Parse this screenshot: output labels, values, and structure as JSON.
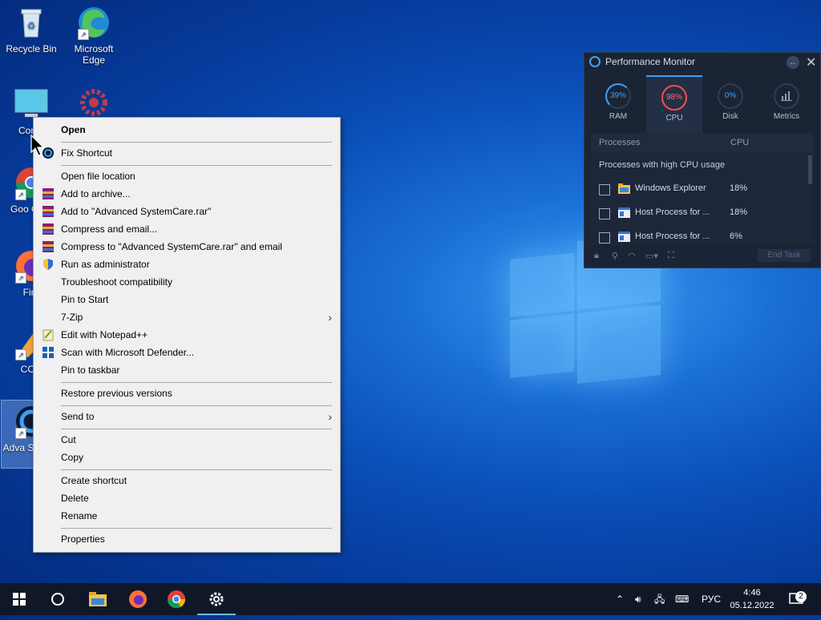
{
  "desktop": {
    "icons": [
      {
        "label": "Recycle Bin"
      },
      {
        "label": "Microsoft Edge"
      },
      {
        "label": "Comp"
      },
      {
        "label": "Goo Chro"
      },
      {
        "label": "Fire"
      },
      {
        "label": "CCle"
      },
      {
        "label": "Adva System"
      }
    ]
  },
  "context_menu": {
    "items": [
      {
        "label": "Open"
      },
      {
        "label": "Fix Shortcut"
      },
      {
        "label": "Open file location"
      },
      {
        "label": "Add to archive..."
      },
      {
        "label": "Add to \"Advanced SystemCare.rar\""
      },
      {
        "label": "Compress and email..."
      },
      {
        "label": "Compress to \"Advanced SystemCare.rar\" and email"
      },
      {
        "label": "Run as administrator"
      },
      {
        "label": "Troubleshoot compatibility"
      },
      {
        "label": "Pin to Start"
      },
      {
        "label": "7-Zip"
      },
      {
        "label": "Edit with Notepad++"
      },
      {
        "label": "Scan with Microsoft Defender..."
      },
      {
        "label": "Pin to taskbar"
      },
      {
        "label": "Restore previous versions"
      },
      {
        "label": "Send to"
      },
      {
        "label": "Cut"
      },
      {
        "label": "Copy"
      },
      {
        "label": "Create shortcut"
      },
      {
        "label": "Delete"
      },
      {
        "label": "Rename"
      },
      {
        "label": "Properties"
      }
    ],
    "submenu_glyph": "›"
  },
  "perf_monitor": {
    "title": "Performance Monitor",
    "tabs": [
      {
        "label": "RAM",
        "value": "39%",
        "color": "#3da0ff"
      },
      {
        "label": "CPU",
        "value": "98%",
        "color": "#ff4b4b"
      },
      {
        "label": "Disk",
        "value": "0%",
        "color": "#3da0ff"
      },
      {
        "label": "Metrics",
        "value": "",
        "color": "#8ea0bd"
      }
    ],
    "columns": {
      "processes": "Processes",
      "cpu": "CPU"
    },
    "category": "Processes with high CPU usage",
    "processes": [
      {
        "name": "Windows Explorer",
        "cpu": "18%",
        "icon": "folder-icon"
      },
      {
        "name": "Host Process for ...",
        "cpu": "18%",
        "icon": "window-icon"
      },
      {
        "name": "Host Process for ...",
        "cpu": "6%",
        "icon": "window-icon"
      }
    ],
    "end_task": "End Task"
  },
  "taskbar": {
    "lang": "РУС",
    "time": "4:46",
    "date": "05.12.2022",
    "notifications": "2"
  }
}
